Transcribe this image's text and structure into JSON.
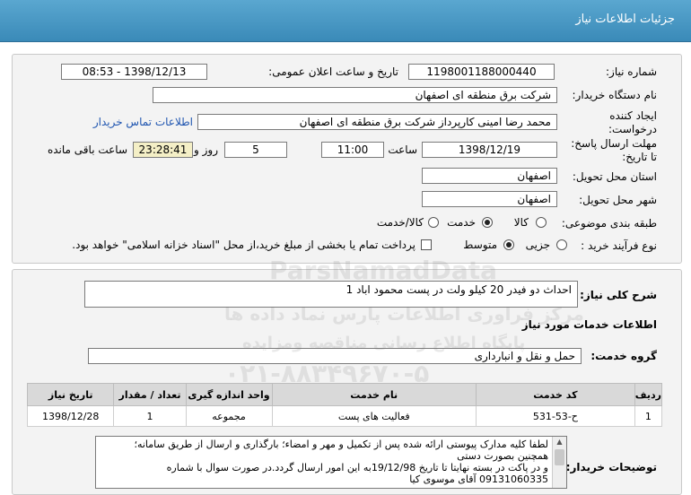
{
  "header": {
    "title": "جزئیات اطلاعات نیاز"
  },
  "info": {
    "need_number_label": "شماره نیاز:",
    "need_number": "1198001188000440",
    "announce_label": "تاریخ و ساعت اعلان عمومی:",
    "announce_value": "1398/12/13 - 08:53",
    "buyer_label": "نام دستگاه خریدار:",
    "buyer_value": "شرکت برق منطقه ای اصفهان",
    "creator_label_1": "ایجاد کننده",
    "creator_label_2": "درخواست:",
    "creator_value": "محمد رضا امینی کارپرداز شرکت برق منطقه ای اصفهان",
    "contact_link": "اطلاعات تماس خریدار",
    "deadline_label_1": "مهلت ارسال پاسخ:",
    "deadline_label_2": "تا تاریخ:",
    "deadline_date": "1398/12/19",
    "time_label": "ساعت",
    "deadline_time": "11:00",
    "days_value": "5",
    "days_label": "روز و",
    "remaining_time": "23:28:41",
    "remaining_label": "ساعت باقی مانده",
    "province_label": "استان محل تحویل:",
    "province_value": "اصفهان",
    "city_label": "شهر محل تحویل:",
    "city_value": "اصفهان",
    "category_label": "طبقه بندی موضوعی:",
    "category_options": [
      "کالا",
      "خدمت",
      "کالا/خدمت"
    ],
    "category_selected": "خدمت",
    "process_label": "نوع فرآیند خرید :",
    "process_options": [
      "جزیی",
      "متوسط"
    ],
    "process_selected": "متوسط",
    "payment_note": "پرداخت تمام یا بخشی از مبلغ خرید،از محل \"اسناد خزانه اسلامی\" خواهد بود."
  },
  "details": {
    "summary_label": "شرح کلی نیاز:",
    "summary_value": "احداث دو فیدر 20 کیلو ولت در پست محمود اباد 1",
    "services_heading": "اطلاعات خدمات مورد نیاز",
    "group_label": "گروه خدمت:",
    "group_value": "حمل و نقل و انبارداری",
    "table": {
      "headers": [
        "ردیف",
        "کد خدمت",
        "نام خدمت",
        "واحد اندازه گیری",
        "تعداد / مقدار",
        "تاریخ نیاز"
      ],
      "rows": [
        [
          "1",
          "ح-53-531",
          "فعالیت های پست",
          "مجموعه",
          "1",
          "1398/12/28"
        ]
      ]
    },
    "notes_label": "توضیحات خریدار:",
    "notes_lines": [
      "لطفا کلیه مدارک پیوستی ارائه شده  پس از تکمیل و مهر و امضاء؛ بارگذاری و ارسال از طریق سامانه؛",
      "همچنین بصورت دستی",
      "و در پاکت در بسته نهایتا تا تاریخ 19/12/98به این امور ارسال گردد.در صورت سوال با شماره",
      "09131060335 آقای موسوی کیا"
    ]
  },
  "watermark": {
    "line1": "ParsNamadData",
    "line2": "مرکز فراوری اطلاعات پارس نماد داده ها",
    "line3": "پایگاه اطلاع رسانی مناقصه ومزایده",
    "line4": "۰۲۱-۸۸۳۴۹۶۷۰-۵"
  }
}
